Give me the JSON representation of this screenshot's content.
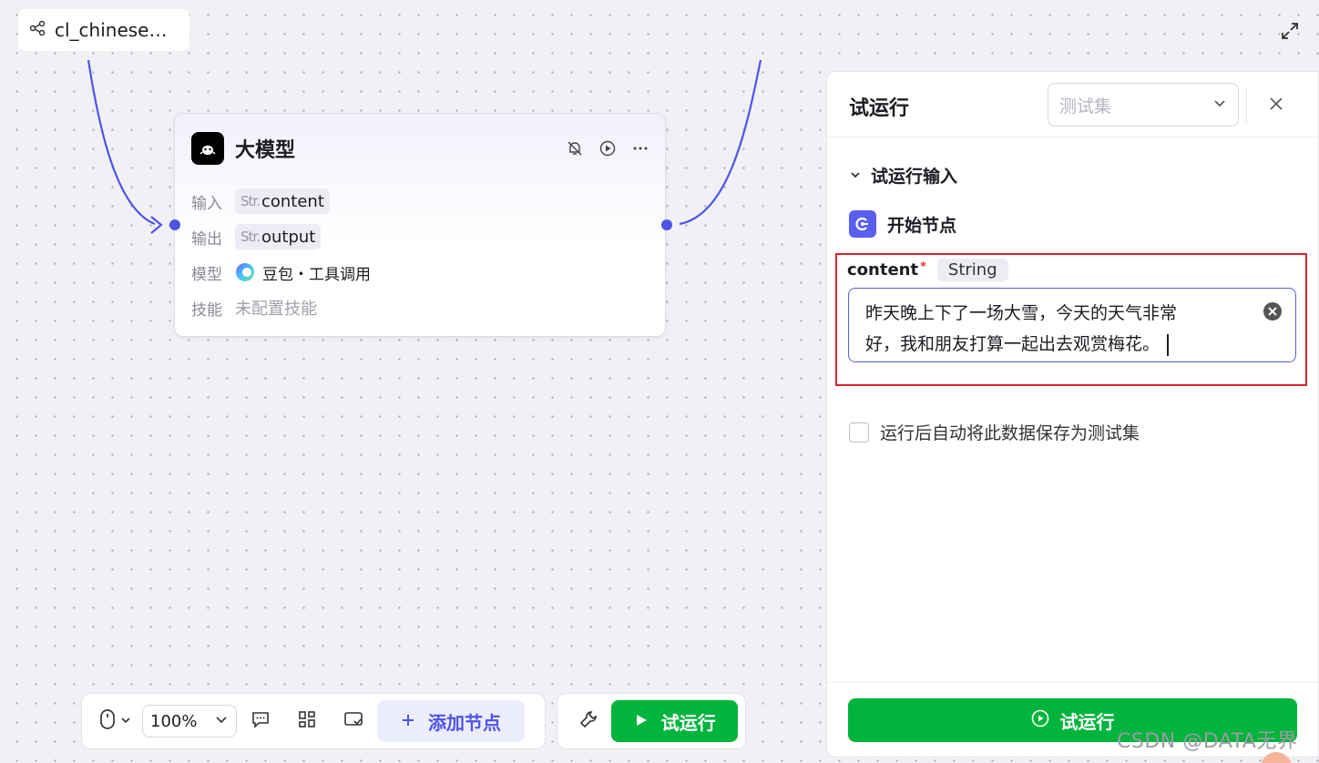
{
  "workflow": {
    "title": "cl_chinese…"
  },
  "node": {
    "title": "大模型",
    "rows": {
      "input_label": "输入",
      "input_type": "Str.",
      "input_value": "content",
      "output_label": "输出",
      "output_type": "Str.",
      "output_value": "output",
      "model_label": "模型",
      "model_value": "豆包・工具调用",
      "skill_label": "技能",
      "skill_value": "未配置技能"
    }
  },
  "panel": {
    "title": "试运行",
    "testset_placeholder": "测试集",
    "section_title": "试运行输入",
    "start_node": "开始节点",
    "field": {
      "name": "content",
      "required_mark": "*",
      "type": "String",
      "value_line1": "昨天晚上下了一场大雪，今天的天气非常",
      "value_line2": "好，我和朋友打算一起出去观赏梅花。"
    },
    "checkbox_label": "运行后自动将此数据保存为测试集",
    "run_button": "试运行"
  },
  "toolbar": {
    "zoom": "100%",
    "add_node": "添加节点",
    "run": "试运行"
  },
  "watermark": "CSDN @DATA无界",
  "colors": {
    "accent": "#4d53e8",
    "run_green": "#00b43c",
    "highlight_red": "#d8232a"
  }
}
